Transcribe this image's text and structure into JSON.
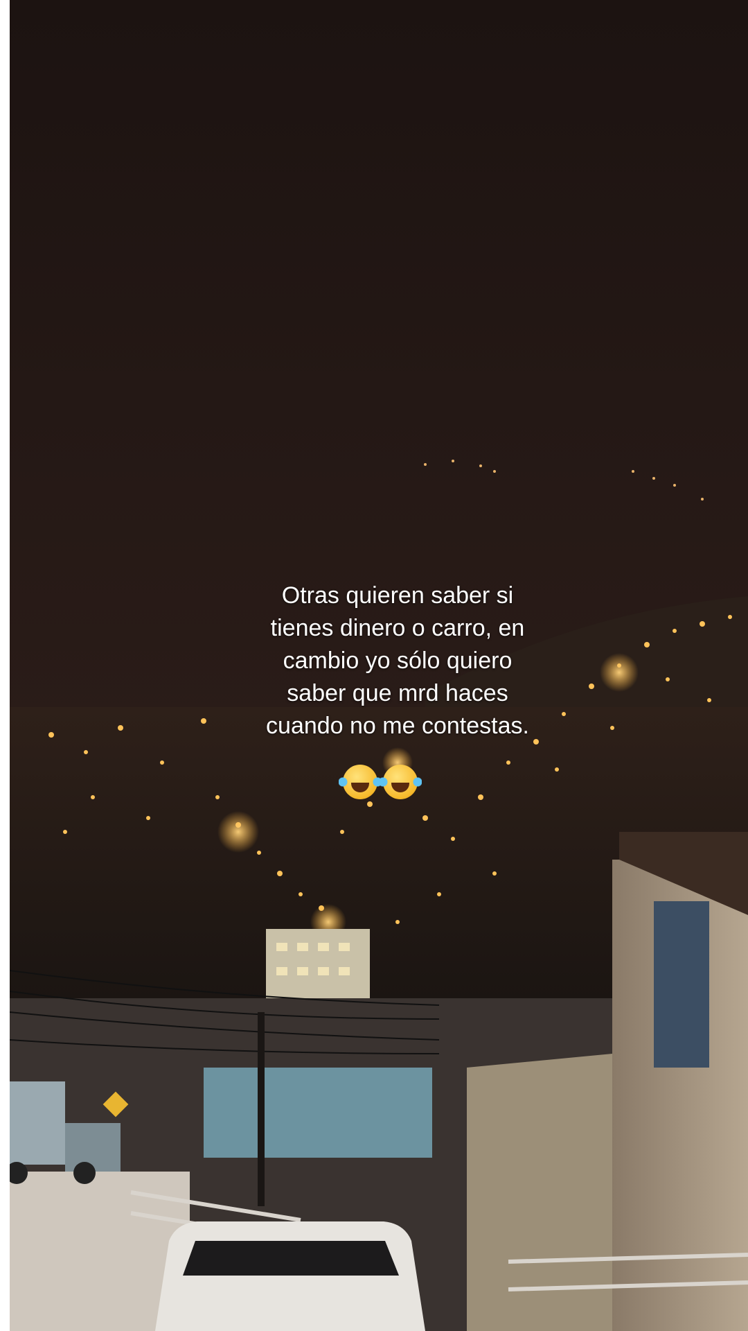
{
  "caption": {
    "text": "Otras quieren saber si\ntienes dinero o carro, en\ncambio yo sólo quiero\nsaber que mrd haces\ncuando no me contestas."
  },
  "emoji": {
    "count": 2,
    "icon": "face-with-tears-of-joy-icon"
  },
  "colors": {
    "sky": "#241815",
    "city_light": "#ffb23a",
    "caption_text": "#ffffff"
  }
}
